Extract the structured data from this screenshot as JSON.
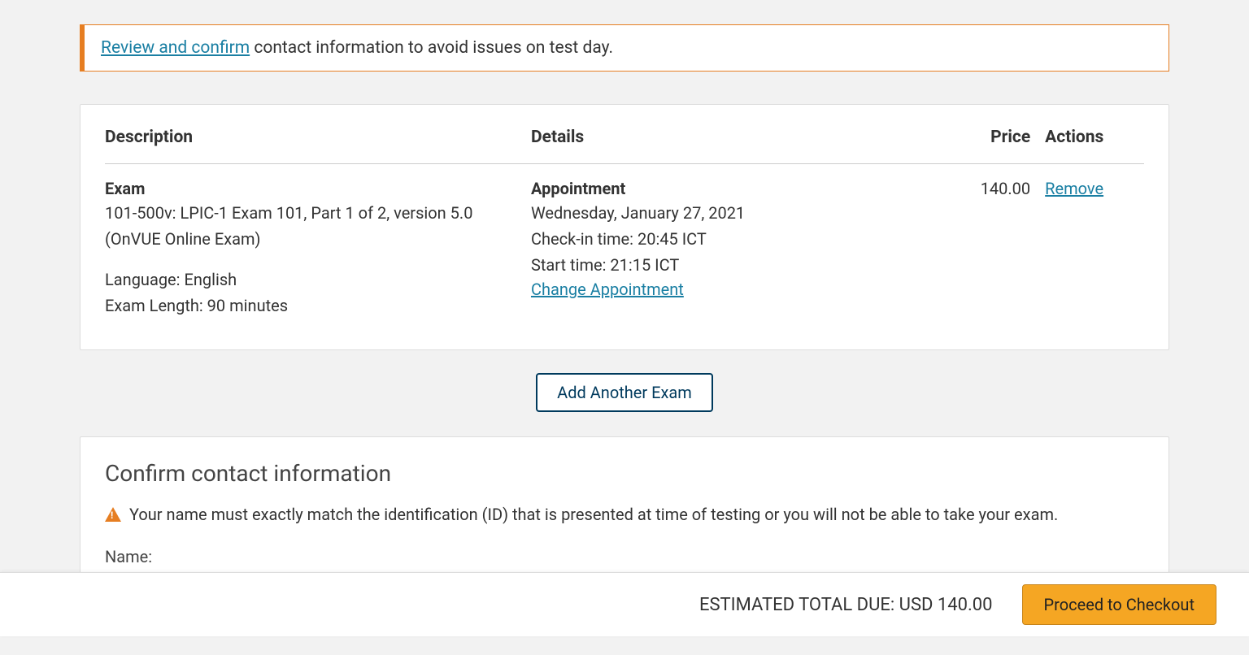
{
  "alert": {
    "link_text": "Review and confirm",
    "text_after": " contact information to avoid issues on test day."
  },
  "table": {
    "headers": {
      "description": "Description",
      "details": "Details",
      "price": "Price",
      "actions": "Actions"
    },
    "row": {
      "desc_heading": "Exam",
      "desc_line1": "101-500v: LPIC-1 Exam 101, Part 1 of 2, version 5.0",
      "desc_line2": "(OnVUE Online Exam)",
      "language": "Language: English",
      "exam_length": "Exam Length: 90 minutes",
      "details_heading": "Appointment",
      "date": "Wednesday, January 27, 2021",
      "checkin": "Check-in time: 20:45 ICT",
      "start": "Start time: 21:15 ICT",
      "change_link": "Change Appointment",
      "price": "140.00",
      "remove_link": "Remove"
    }
  },
  "buttons": {
    "add_another": "Add Another Exam",
    "proceed": "Proceed to Checkout"
  },
  "contact_section": {
    "title": "Confirm contact information",
    "warning": "Your name must exactly match the identification (ID) that is presented at time of testing or you will not be able to take your exam.",
    "name_label": "Name:"
  },
  "footer": {
    "total": "ESTIMATED TOTAL DUE: USD 140.00"
  }
}
